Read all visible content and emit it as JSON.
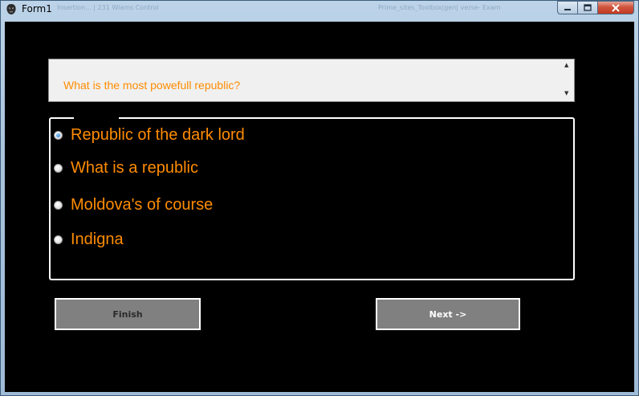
{
  "window": {
    "title": "Form1",
    "ghost_text_left": "Insertion... | 231 Wiams Control",
    "ghost_text_right": "Prime_sites_Toolbox|gen| verse- Exam"
  },
  "caption_buttons": {
    "minimize_icon": "minimize-icon",
    "maximize_icon": "maximize-icon",
    "close_icon": "close-icon"
  },
  "question": {
    "text": "What is the most powefull republic?"
  },
  "answers": {
    "options": [
      {
        "label": "Republic of the dark lord",
        "selected": true
      },
      {
        "label": "What is a republic",
        "selected": false
      },
      {
        "label": "Moldova's of course",
        "selected": false
      },
      {
        "label": "Indigna",
        "selected": false
      }
    ]
  },
  "buttons": {
    "finish_label": "Finish",
    "next_label": "Next ->"
  },
  "colors": {
    "answer_text": "#ff8c00",
    "client_background": "#000000",
    "button_background": "#808080"
  }
}
